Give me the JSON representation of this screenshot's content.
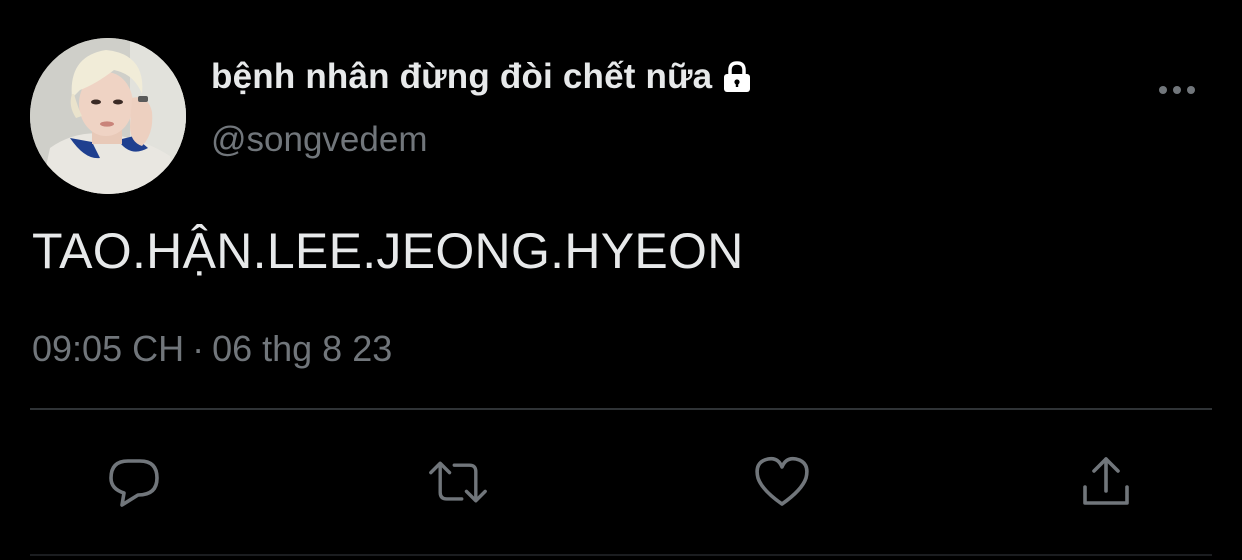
{
  "tweet": {
    "author": {
      "display_name": "bệnh nhân đừng đòi chết nữa",
      "handle": "@songvedem",
      "protected_icon": "lock-icon",
      "avatar_icon": "profile-photo"
    },
    "text": "TAO.HẬN.LEE.JEONG.HYEON",
    "time": "09:05 CH",
    "separator": "·",
    "date": "06 thg 8 23",
    "more_icon": "more-horizontal-icon"
  },
  "actions": [
    {
      "name": "reply",
      "icon": "reply-icon"
    },
    {
      "name": "retweet",
      "icon": "retweet-icon"
    },
    {
      "name": "like",
      "icon": "heart-icon"
    },
    {
      "name": "share",
      "icon": "share-icon"
    }
  ],
  "colors": {
    "background": "#000000",
    "primary_text": "#e7e9ea",
    "secondary_text": "#71767b",
    "divider": "#2f3336"
  }
}
